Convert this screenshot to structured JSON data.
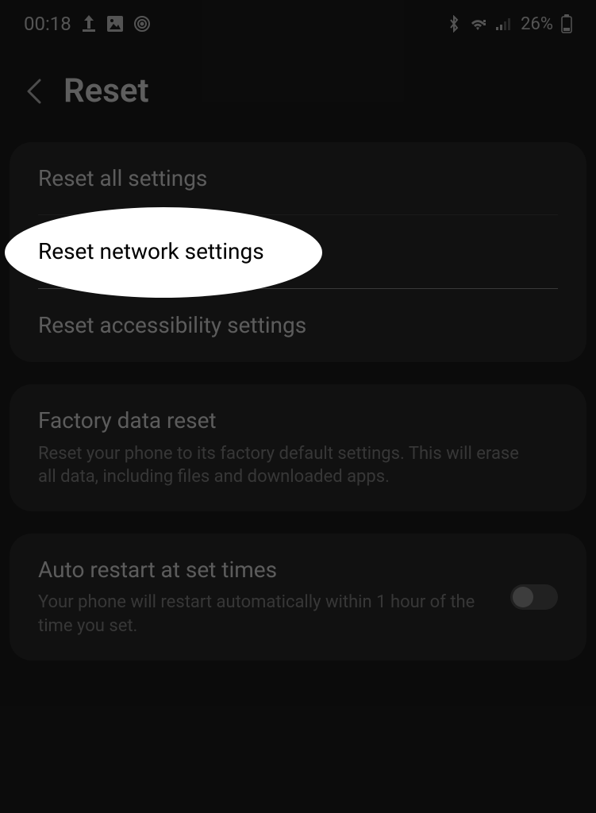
{
  "status": {
    "time": "00:18",
    "battery_text": "26%"
  },
  "header": {
    "title": "Reset"
  },
  "group1": {
    "items": [
      {
        "title": "Reset all settings"
      },
      {
        "title": "Reset network settings"
      },
      {
        "title": "Reset accessibility settings"
      }
    ]
  },
  "group2": {
    "title": "Factory data reset",
    "desc": "Reset your phone to its factory default settings. This will erase all data, including files and downloaded apps."
  },
  "group3": {
    "title": "Auto restart at set times",
    "desc": "Your phone will restart automatically within 1 hour of the time you set."
  }
}
